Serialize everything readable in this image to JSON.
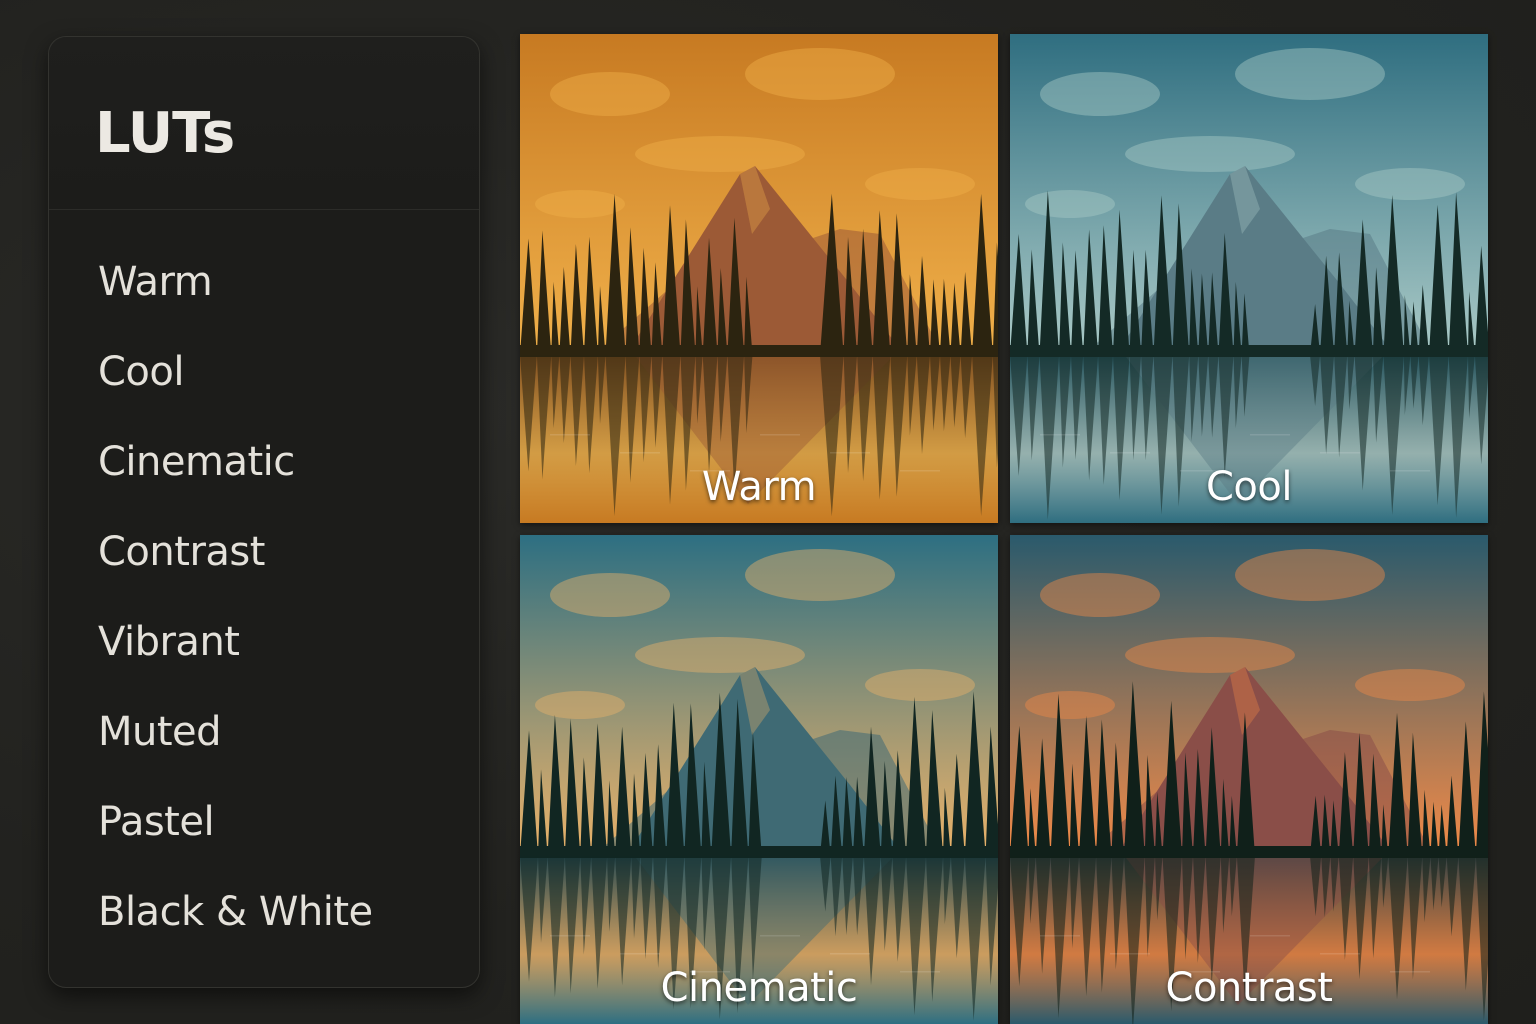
{
  "panel": {
    "title": "LUTs",
    "items": [
      {
        "label": "Warm"
      },
      {
        "label": "Cool"
      },
      {
        "label": "Cinematic"
      },
      {
        "label": "Contrast"
      },
      {
        "label": "Vibrant"
      },
      {
        "label": "Muted"
      },
      {
        "label": "Pastel"
      },
      {
        "label": "Black & White"
      }
    ]
  },
  "previews": [
    {
      "label": "Warm",
      "colors": {
        "sky_top": "#c77a22",
        "sky_bottom": "#f0b04a",
        "mountain": "#9c5a36",
        "trees": "#2c2410",
        "water": "#7a4a1e"
      }
    },
    {
      "label": "Cool",
      "colors": {
        "sky_top": "#2f6e80",
        "sky_bottom": "#a9c9c6",
        "mountain": "#5a7c86",
        "trees": "#142a26",
        "water": "#1f4e58"
      }
    },
    {
      "label": "Cinematic",
      "colors": {
        "sky_top": "#2d6f82",
        "sky_bottom": "#e9b26a",
        "mountain": "#3f6a74",
        "trees": "#112622",
        "water": "#1c4450"
      }
    },
    {
      "label": "Contrast",
      "colors": {
        "sky_top": "#2a5a6c",
        "sky_bottom": "#f08a48",
        "mountain": "#8a4e48",
        "trees": "#10201a",
        "water": "#2a3e44"
      }
    }
  ]
}
